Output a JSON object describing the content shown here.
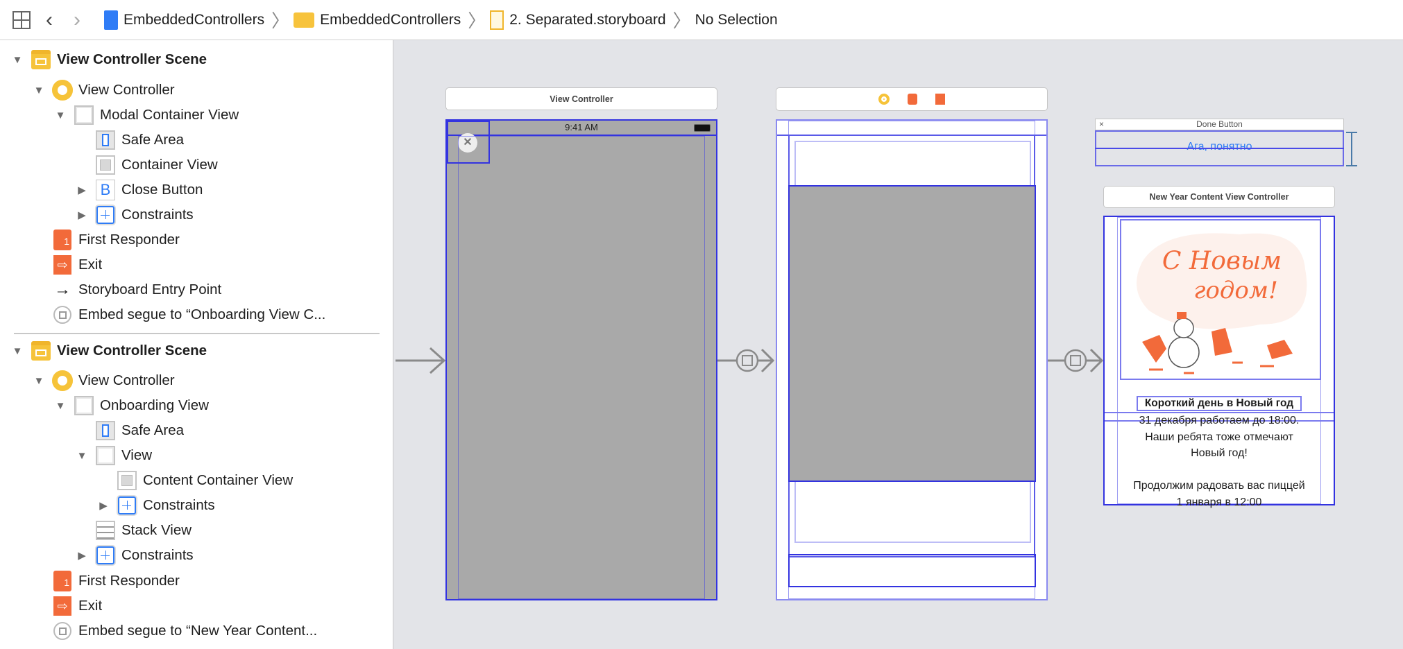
{
  "toolbar": {
    "breadcrumbs": [
      {
        "label": "EmbeddedControllers",
        "icon": "project-icon"
      },
      {
        "label": "EmbeddedControllers",
        "icon": "folder-icon"
      },
      {
        "label": "2. Separated.storyboard",
        "icon": "storyboard-icon"
      },
      {
        "label": "No Selection"
      }
    ]
  },
  "outline": {
    "scene1": {
      "title": "View Controller Scene",
      "items": [
        "View Controller",
        "Modal Container View",
        "Safe Area",
        "Container View",
        "Close Button",
        "Constraints",
        "First Responder",
        "Exit",
        "Storyboard Entry Point",
        "Embed segue to “Onboarding View C..."
      ]
    },
    "scene2": {
      "title": "View Controller Scene",
      "items": [
        "View Controller",
        "Onboarding View",
        "Safe Area",
        "View",
        "Content Container View",
        "Constraints",
        "Stack View",
        "Constraints",
        "First Responder",
        "Exit",
        "Embed segue to “New Year Content..."
      ]
    }
  },
  "canvas": {
    "vc1": {
      "title": "View Controller",
      "time": "9:41 AM",
      "close_glyph": "✕"
    },
    "done": {
      "title": "Done Button",
      "close_glyph": "×",
      "button": "Ага, понятно"
    },
    "nyc": {
      "title": "New Year Content View Controller",
      "image_lettering": "С Новым годом!",
      "heading": "Короткий день в Новый год",
      "body": [
        "31 декабря работаем до 18:00.",
        "Наши ребята тоже отмечают",
        "Новый год!",
        "",
        "Продолжим радовать вас пиццей",
        "1 января в 12:00"
      ]
    }
  },
  "colors": {
    "selection_blue": "#3333e0",
    "link_blue": "#2f7cf6",
    "orange": "#f26a3a",
    "yellow": "#f6c339",
    "scene_gray": "#a9a9a9"
  }
}
